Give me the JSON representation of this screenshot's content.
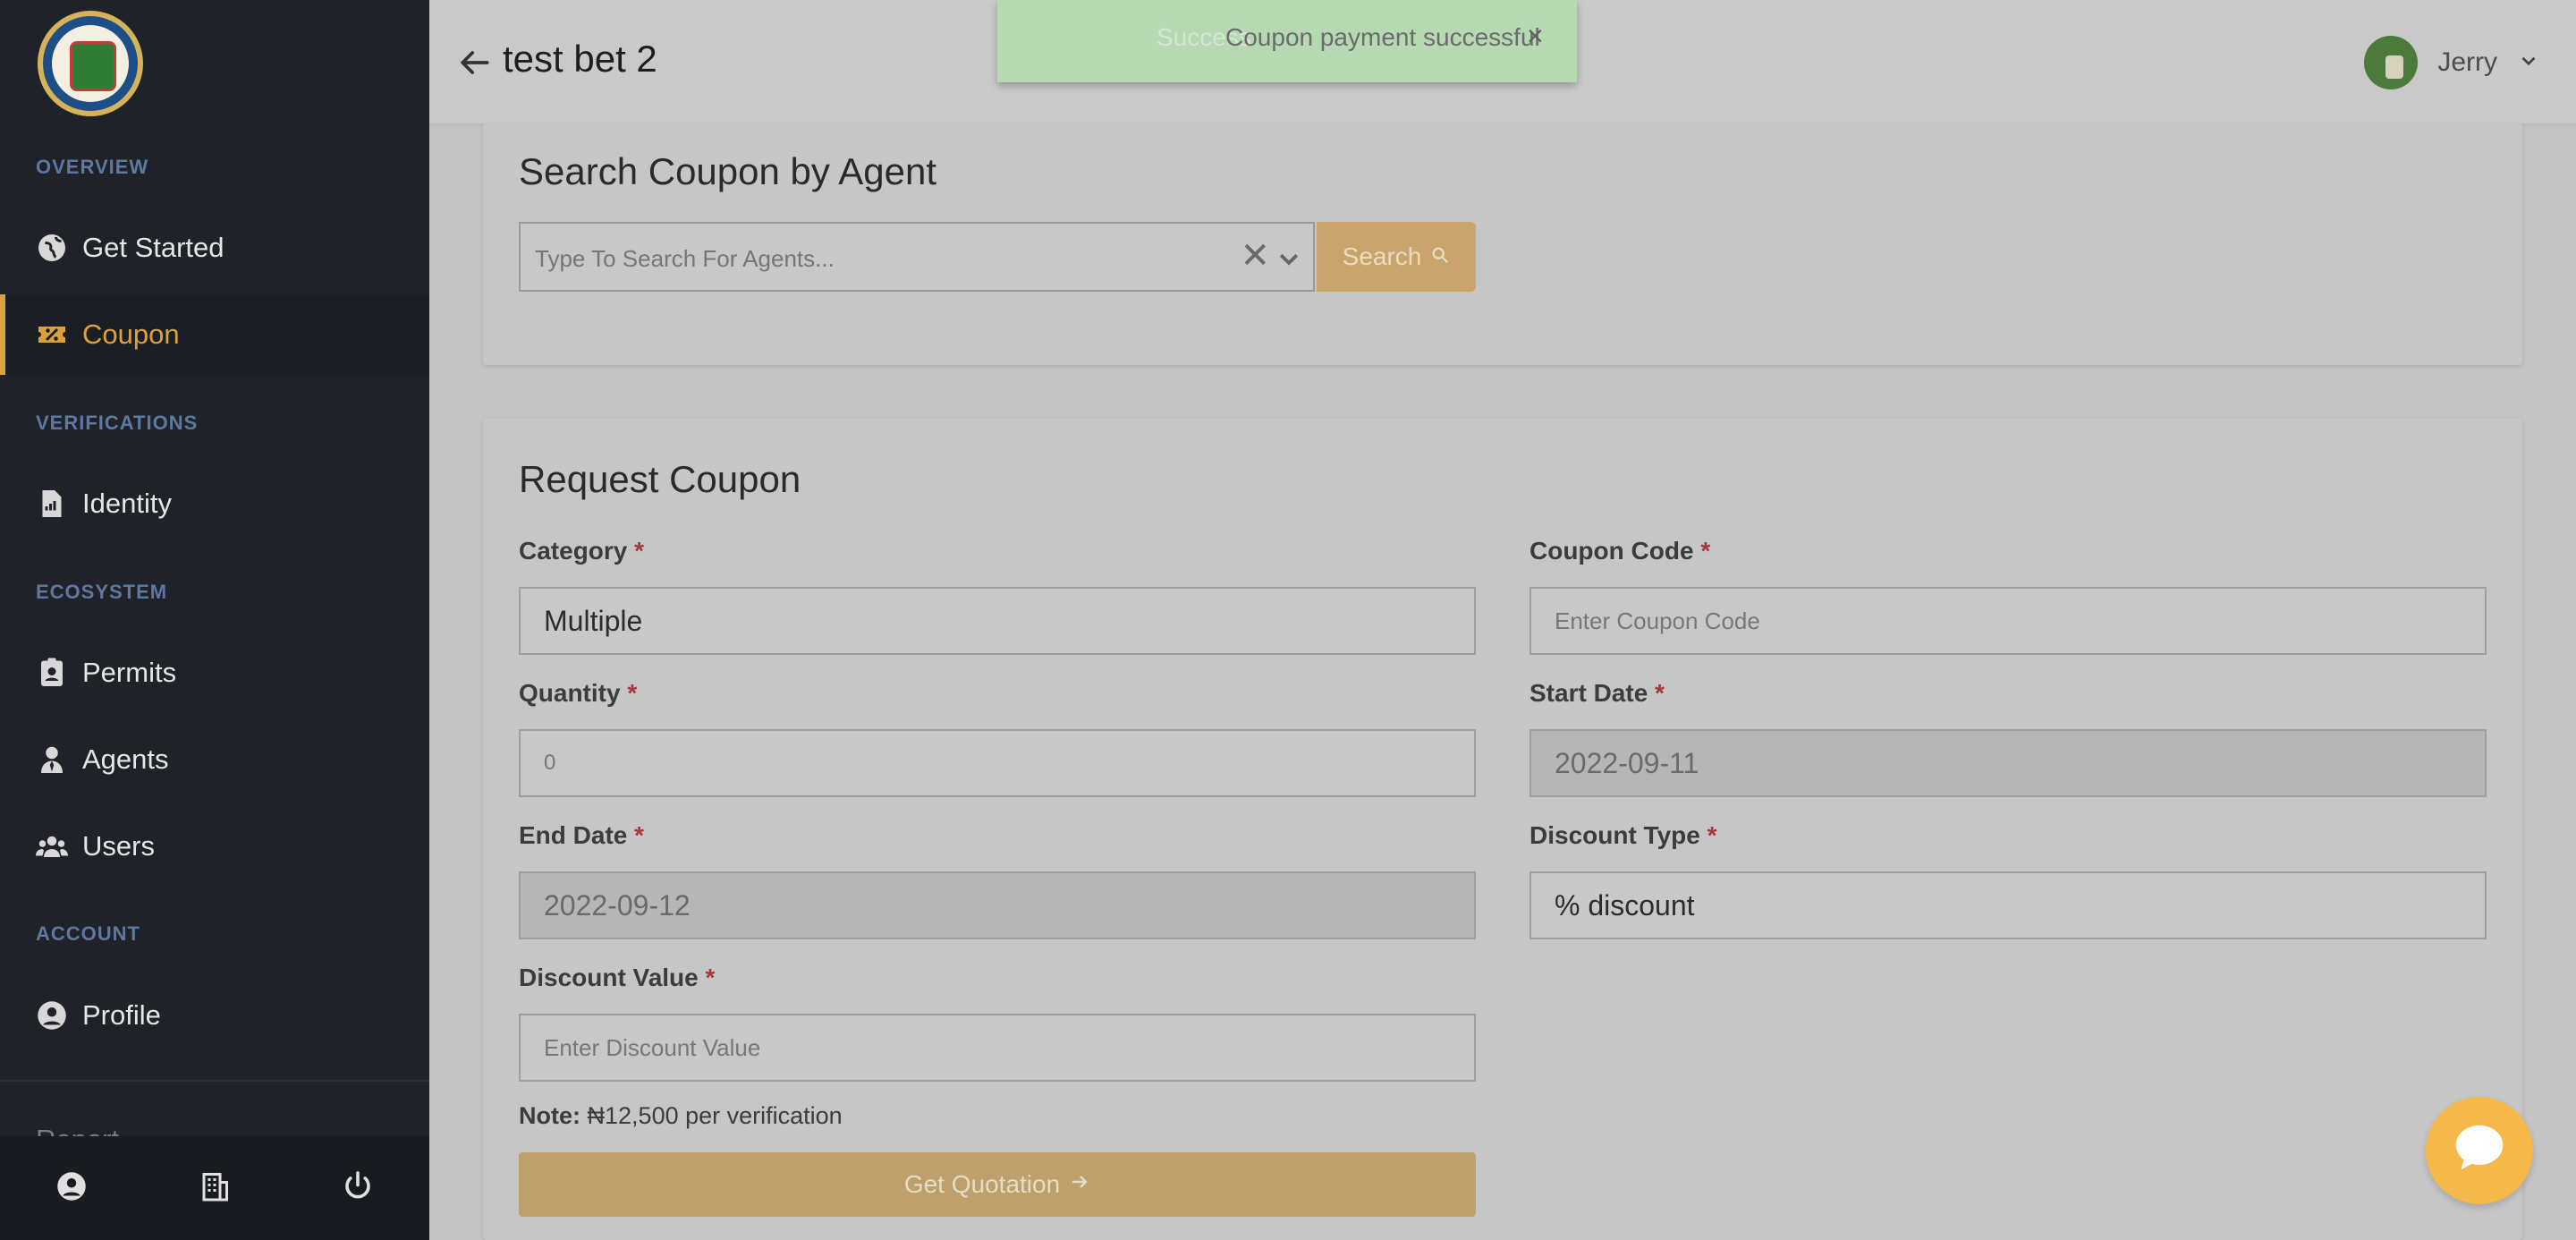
{
  "sidebar": {
    "sections": {
      "overview": "OVERVIEW",
      "verifications": "VERIFICATIONS",
      "ecosystem": "ECOSYSTEM",
      "account": "ACCOUNT"
    },
    "items": [
      {
        "label": "Get Started",
        "icon": "globe-icon"
      },
      {
        "label": "Coupon",
        "icon": "coupon-icon",
        "active": true
      },
      {
        "label": "Identity",
        "icon": "document-icon"
      },
      {
        "label": "Permits",
        "icon": "badge-icon"
      },
      {
        "label": "Agents",
        "icon": "agent-icon"
      },
      {
        "label": "Users",
        "icon": "users-icon"
      },
      {
        "label": "Profile",
        "icon": "user-circle-icon"
      },
      {
        "label": "Report",
        "icon": "clipboard-icon"
      }
    ],
    "footer_icons": [
      "user-circle-icon",
      "building-icon",
      "power-icon"
    ]
  },
  "header": {
    "title": "test bet 2",
    "user_name": "Jerry"
  },
  "toast": {
    "ghost_text": "Success",
    "message": "Coupon payment successful",
    "close": "×"
  },
  "search_card": {
    "title": "Search Coupon by Agent",
    "placeholder": "Type To Search For Agents...",
    "clear": "✕",
    "button_label": "Search"
  },
  "request_card": {
    "title": "Request Coupon",
    "fields": {
      "category": {
        "label": "Category",
        "value": "Multiple"
      },
      "coupon_code": {
        "label": "Coupon Code",
        "placeholder": "Enter Coupon Code"
      },
      "quantity": {
        "label": "Quantity",
        "value": "0"
      },
      "start_date": {
        "label": "Start Date",
        "value": "2022-09-11"
      },
      "end_date": {
        "label": "End Date",
        "value": "2022-09-12"
      },
      "discount_type": {
        "label": "Discount Type",
        "value": "% discount"
      },
      "discount_value": {
        "label": "Discount Value",
        "placeholder": "Enter Discount Value"
      }
    },
    "required_mark": "*",
    "note_label": "Note:",
    "note_text": "₦12,500 per verification",
    "quote_button": "Get Quotation"
  },
  "colors": {
    "accent": "#d9a23d",
    "sidebar_bg": "#1f2329",
    "toast_bg": "#b6d9b3",
    "chat_bg": "#f7b84b"
  }
}
